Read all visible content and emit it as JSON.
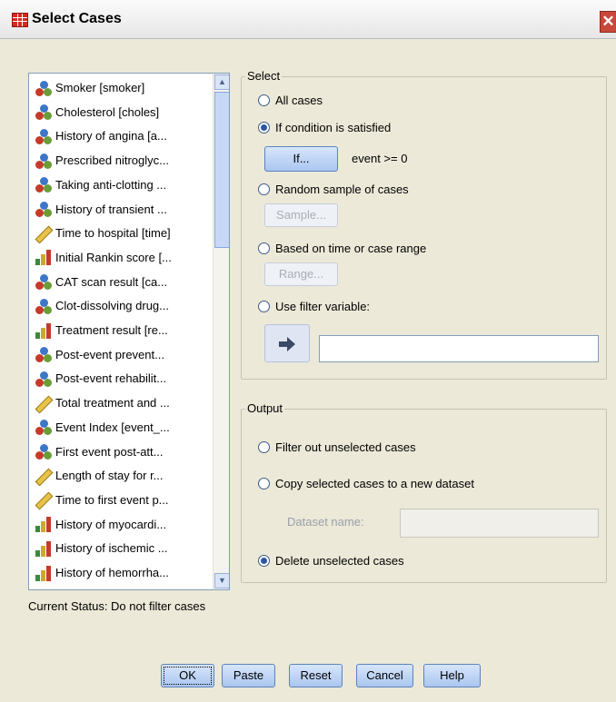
{
  "window": {
    "title": "Select Cases"
  },
  "variables": [
    {
      "label": "Smoker [smoker]",
      "type": "nominal"
    },
    {
      "label": "Cholesterol [choles]",
      "type": "nominal"
    },
    {
      "label": "History of angina [a...",
      "type": "nominal"
    },
    {
      "label": "Prescribed nitroglyc...",
      "type": "nominal"
    },
    {
      "label": "Taking anti-clotting ...",
      "type": "nominal"
    },
    {
      "label": "History of transient ...",
      "type": "nominal"
    },
    {
      "label": "Time to hospital [time]",
      "type": "scale"
    },
    {
      "label": "Initial Rankin score [...",
      "type": "ordinal"
    },
    {
      "label": "CAT scan result [ca...",
      "type": "nominal"
    },
    {
      "label": "Clot-dissolving drug...",
      "type": "nominal"
    },
    {
      "label": "Treatment result [re...",
      "type": "ordinal"
    },
    {
      "label": "Post-event prevent...",
      "type": "nominal"
    },
    {
      "label": "Post-event rehabilit...",
      "type": "nominal"
    },
    {
      "label": "Total treatment and ...",
      "type": "scale"
    },
    {
      "label": "Event Index [event_...",
      "type": "nominal"
    },
    {
      "label": "First event post-att...",
      "type": "nominal"
    },
    {
      "label": "Length of stay for r...",
      "type": "scale"
    },
    {
      "label": "Time to first event p...",
      "type": "scale"
    },
    {
      "label": "History of myocardi...",
      "type": "ordinal"
    },
    {
      "label": "History of ischemic ...",
      "type": "ordinal"
    },
    {
      "label": "History of hemorrha...",
      "type": "ordinal"
    }
  ],
  "select": {
    "group_title": "Select",
    "all_cases": "All cases",
    "if_condition": "If condition is satisfied",
    "if_button": "If...",
    "condition_text": "event >= 0",
    "random_sample": "Random sample of cases",
    "sample_button": "Sample...",
    "time_range": "Based on time or case range",
    "range_button": "Range...",
    "filter_variable": "Use filter variable:",
    "filter_value": ""
  },
  "output": {
    "group_title": "Output",
    "filter_out": "Filter out unselected cases",
    "copy_selected": "Copy selected cases to a new dataset",
    "dataset_name_label": "Dataset name:",
    "dataset_name_value": "",
    "delete_unselected": "Delete unselected cases"
  },
  "status": "Current Status: Do not filter cases",
  "buttons": {
    "ok": "OK",
    "paste": "Paste",
    "reset": "Reset",
    "cancel": "Cancel",
    "help": "Help"
  },
  "colors": {
    "accent": "#2d55a8",
    "dialog_bg": "#ece9d8",
    "close": "#c8473a"
  }
}
